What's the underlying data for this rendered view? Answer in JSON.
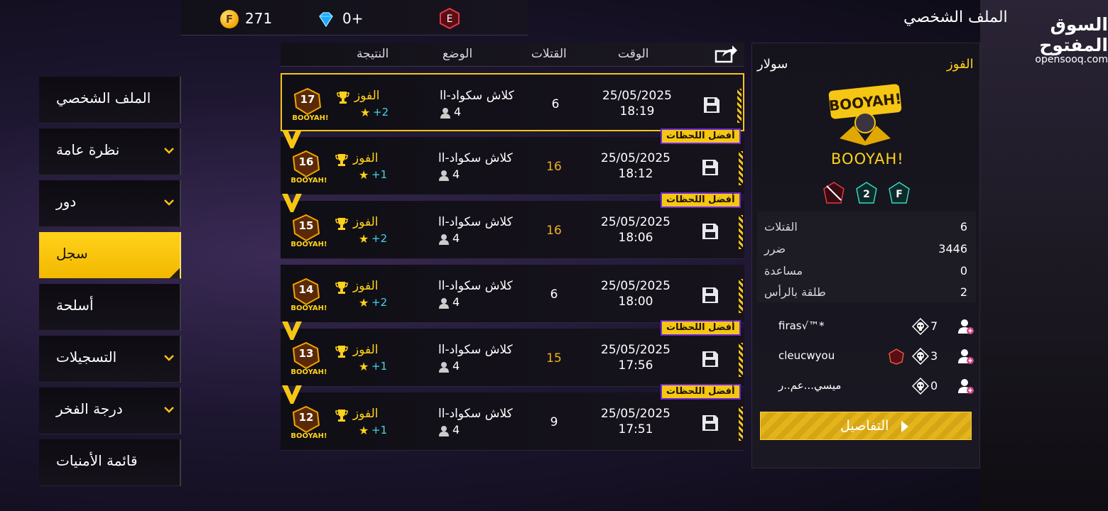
{
  "header": {
    "title": "الملف الشخصي",
    "coins": "271",
    "diamonds": "0+",
    "rank_letter": "E",
    "watermark_ar": "السوق المفتوح",
    "watermark_en": "opensooq.com"
  },
  "sidebar": {
    "items": [
      {
        "label": "الملف الشخصي",
        "chevron": false,
        "active": false
      },
      {
        "label": "نظرة عامة",
        "chevron": true,
        "active": false
      },
      {
        "label": "دور",
        "chevron": true,
        "active": false
      },
      {
        "label": "سجل",
        "chevron": false,
        "active": true
      },
      {
        "label": "أسلحة",
        "chevron": false,
        "active": false
      },
      {
        "label": "التسجيلات",
        "chevron": true,
        "active": false
      },
      {
        "label": "درجة الفخر",
        "chevron": true,
        "active": false
      },
      {
        "label": "قائمة الأمنيات",
        "chevron": false,
        "active": false
      }
    ]
  },
  "table": {
    "headers": {
      "time": "الوقت",
      "kills": "القتلات",
      "mode": "الوضع",
      "result": "النتيجة"
    },
    "highlight_tag": "أفضل اللحظات",
    "rows": [
      {
        "rank": "17",
        "result": "الفوز",
        "plus": "+2",
        "mode": "كلاش سكواد-اا",
        "players": "4",
        "kills": "6",
        "date": "25/05/2025",
        "time": "18:19",
        "highlight": false,
        "selected": true
      },
      {
        "rank": "16",
        "result": "الفوز",
        "plus": "+1",
        "mode": "كلاش سكواد-اا",
        "players": "4",
        "kills": "16",
        "date": "25/05/2025",
        "time": "18:12",
        "highlight": true,
        "selected": false
      },
      {
        "rank": "15",
        "result": "الفوز",
        "plus": "+2",
        "mode": "كلاش سكواد-اا",
        "players": "4",
        "kills": "16",
        "date": "25/05/2025",
        "time": "18:06",
        "highlight": true,
        "selected": false
      },
      {
        "rank": "14",
        "result": "الفوز",
        "plus": "+2",
        "mode": "كلاش سكواد-اا",
        "players": "4",
        "kills": "6",
        "date": "25/05/2025",
        "time": "18:00",
        "highlight": false,
        "selected": false
      },
      {
        "rank": "13",
        "result": "الفوز",
        "plus": "+1",
        "mode": "كلاش سكواد-اا",
        "players": "4",
        "kills": "15",
        "date": "25/05/2025",
        "time": "17:56",
        "highlight": true,
        "selected": false
      },
      {
        "rank": "12",
        "result": "الفوز",
        "plus": "+1",
        "mode": "كلاش سكواد-اا",
        "players": "4",
        "kills": "9",
        "date": "25/05/2025",
        "time": "17:51",
        "highlight": true,
        "selected": false
      }
    ]
  },
  "panel": {
    "result": "الفوز",
    "player": "سولار",
    "booyah": "BOOYAH!",
    "stats": [
      {
        "label": "القتلات",
        "value": "6"
      },
      {
        "label": "ضرر",
        "value": "3446"
      },
      {
        "label": "مساعدة",
        "value": "0"
      },
      {
        "label": "طلقة بالرأس",
        "value": "2"
      }
    ],
    "teammates": [
      {
        "name": "firas√™*",
        "kills": "7"
      },
      {
        "name": "cleucwyou",
        "kills": "3"
      },
      {
        "name": "ميسي...عم..ر",
        "kills": "0"
      }
    ],
    "details_label": "التفاصيل"
  }
}
